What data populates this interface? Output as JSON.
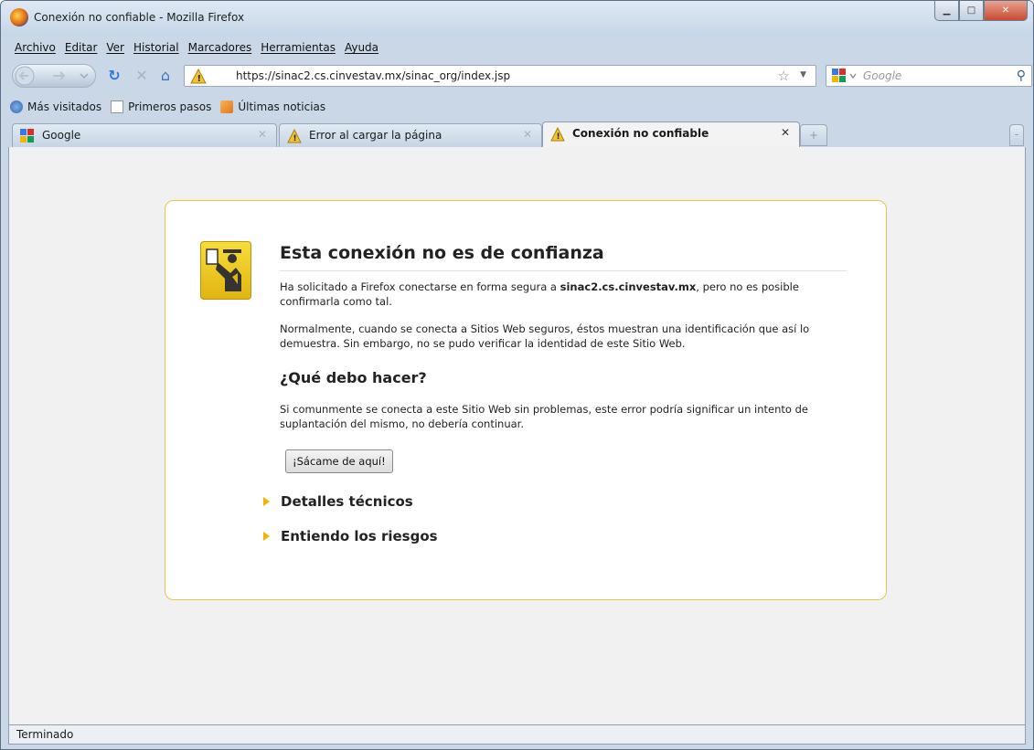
{
  "window": {
    "title": "Conexión no confiable - Mozilla Firefox"
  },
  "menu": [
    "Archivo",
    "Editar",
    "Ver",
    "Historial",
    "Marcadores",
    "Herramientas",
    "Ayuda"
  ],
  "nav": {
    "url": "https://sinac2.cs.cinvestav.mx/sinac_org/index.jsp",
    "search_placeholder": "Google"
  },
  "bookmarks": [
    "Más visitados",
    "Primeros pasos",
    "Últimas noticias"
  ],
  "tabs": [
    {
      "label": "Google"
    },
    {
      "label": "Error al cargar la página"
    },
    {
      "label": "Conexión no confiable"
    }
  ],
  "error": {
    "title": "Esta conexión no es de confianza",
    "p1_before": "Ha solicitado a Firefox conectarse en forma segura a ",
    "p1_host": "sinac2.cs.cinvestav.mx",
    "p1_after": ", pero no es posible confirmarla como tal.",
    "p2": "Normalmente, cuando se conecta a Sitios Web seguros, éstos muestran una identificación que así lo demuestra. Sin embargo, no se pudo verificar la identidad de este Sitio Web.",
    "subtitle": "¿Qué debo hacer?",
    "p3": "Si comunmente se conecta a este Sitio Web sin problemas, este error podría significar un intento de suplantación del mismo, no debería continuar.",
    "button": "¡Sácame de aquí!",
    "technical": "Detalles técnicos",
    "risks": "Entiendo los riesgos"
  },
  "status": "Terminado",
  "colors": {
    "accent_warning": "#f0b400",
    "box_border": "#e8c64a",
    "chrome_blue": "#c9d7e6"
  }
}
